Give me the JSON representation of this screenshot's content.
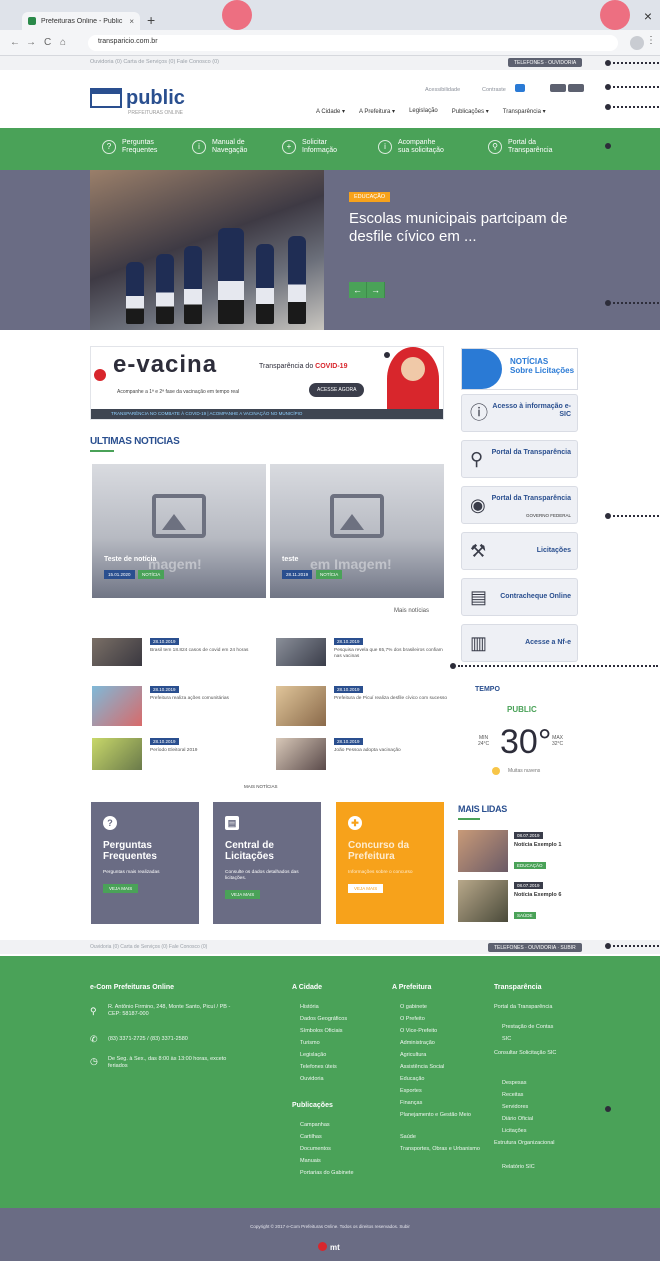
{
  "browser": {
    "tab_title": "Prefeituras Online - Public",
    "tab_close": "×",
    "new_tab": "+",
    "window_close": "×",
    "url": "transparicio.com.br",
    "back": "←",
    "forward": "→",
    "reload": "C",
    "home": "⌂",
    "menu": "⋮"
  },
  "utility": {
    "crumbs": "Ouvidoria (0)   Carta de Serviços (0)   Fale Conosco (0)",
    "telefones_label": "TELEFONES · OUVIDORIA"
  },
  "header": {
    "logo_text": "public",
    "logo_sub": "PREFEITURAS ONLINE",
    "accessibility": "Acessibilidade",
    "contrast": "Contraste",
    "nav": [
      "A Cidade ▾",
      "A Prefeitura ▾",
      "Legislação",
      "Publicações ▾",
      "Transparência ▾"
    ]
  },
  "quicklinks": [
    {
      "icon": "?",
      "label1": "Perguntas",
      "label2": "Frequentes"
    },
    {
      "icon": "i",
      "label1": "Manual de",
      "label2": "Navegação"
    },
    {
      "icon": "+",
      "label1": "Solicitar",
      "label2": "Informação"
    },
    {
      "icon": "i",
      "label1": "Acompanhe",
      "label2": "sua solicitação"
    },
    {
      "icon": "⚲",
      "label1": "Portal da",
      "label2": "Transparência"
    }
  ],
  "hero": {
    "badge": "EDUCAÇÃO",
    "title": "Escolas municipais partcipam de desfile cívico em ...",
    "prev": "←",
    "next": "→"
  },
  "vacina": {
    "title": "e-vacina",
    "subtitle_pre": "Transparência do ",
    "subtitle_hl": "COVID-19",
    "desc": "Acompanhe a 1ª e 2ª fase da vacinação em tempo real",
    "button": "ACESSE AGORA",
    "strip": "TRANSPARÊNCIA NO COMBATE À COVID-19 | ACOMPANHE A VACINAÇÃO NO MUNICÍPIO"
  },
  "ultimas": {
    "title": "ULTIMAS NOTICIAS",
    "cards": [
      {
        "title": "Teste de notícia",
        "watermark": "magem!",
        "date": "15.01.2020",
        "tag": "NOTÍCIA"
      },
      {
        "title": "teste",
        "watermark": "em Imagem!",
        "date": "28.11.2019",
        "tag": "NOTÍCIA"
      }
    ],
    "more": "Mais notícias",
    "list": [
      {
        "date": "28.10.2019",
        "text": "Brasil tem 18.824 casos de covid em 24 horas"
      },
      {
        "date": "28.10.2019",
        "text": "Pesquisa revela que 65,7% dos brasileiros confiam nas vacinas"
      },
      {
        "date": "28.10.2019",
        "text": "Prefeitura realiza ações comunitárias"
      },
      {
        "date": "28.10.2019",
        "text": "Prefeitura de Picuí realiza desfile cívico com sucesso"
      },
      {
        "date": "28.10.2019",
        "text": "Período Eleitoral 2019"
      },
      {
        "date": "28.10.2019",
        "text": "João Pessoa adopta vacinação"
      }
    ],
    "more_news": "MAIS NOTÍCIAS"
  },
  "bottom_cards": [
    {
      "icon": "?",
      "title1": "Perguntas",
      "title2": "Frequentes",
      "desc": "Perguntas mais realizadas",
      "btn": "VEJA MAIS"
    },
    {
      "icon": "▤",
      "title1": "Central de",
      "title2": "Licitações",
      "desc": "Consulte os dados detalhados das licitações.",
      "btn": "VEJA MAIS"
    },
    {
      "icon": "✚",
      "title1": "Concurso da",
      "title2": "Prefeitura",
      "desc": "Informações sobre o concurso",
      "btn": "VEJA MAIS"
    }
  ],
  "sidebar": {
    "noticias_l1": "NOTÍCIAS",
    "noticias_l2": "Sobre Licitações",
    "buttons": [
      {
        "icon": "ⓘ",
        "label": "Acesso à informação e-SIC",
        "sub": ""
      },
      {
        "icon": "⚲",
        "label": "Portal da Transparência",
        "sub": ""
      },
      {
        "icon": "◉",
        "label": "Portal da Transparência",
        "sub": "GOVERNO FEDERAL"
      },
      {
        "icon": "⚒",
        "label": "Licitações",
        "sub": ""
      },
      {
        "icon": "▤",
        "label": "Contracheque Online",
        "sub": ""
      },
      {
        "icon": "▥",
        "label": "Acesse a Nf-e",
        "sub": ""
      }
    ]
  },
  "tempo": {
    "title": "TEMPO",
    "city": "PUBLIC",
    "min_label": "MIN",
    "min": "24°C",
    "value": "30°",
    "max_label": "MAX",
    "max": "32°C",
    "condition": "Muitas nuvens"
  },
  "mais_lidas": {
    "title": "MAIS LIDAS",
    "items": [
      {
        "date": "08.07.2019",
        "title": "Notícia Exemplo 1",
        "tag": "EDUCAÇÃO"
      },
      {
        "date": "08.07.2019",
        "title": "Notícia Exemplo 6",
        "tag": "SAÚDE"
      }
    ]
  },
  "lowbar": {
    "crumbs": "Ouvidoria (0)   Carta de Serviços (0)   Fale Conosco (0)",
    "pill": "TELEFONES · OUVIDORIA · SUBIR"
  },
  "footer": {
    "org": "e-Com Prefeituras Online",
    "address": "R. Antônio Firmino, 248, Monte Santo, Picuí / PB - CEP: 58187-000",
    "phone": "(83) 3371-2725 / (83) 3371-2580",
    "hours": "De Seg. à Sex., das 8:00 às 13:00 horas, exceto feriados",
    "col_cidade": "A Cidade",
    "cidade": [
      "História",
      "Dados Geográficos",
      "Símbolos Oficiais",
      "Turismo",
      "Legislação",
      "Telefones úteis",
      "Ouvidoria"
    ],
    "col_publicacoes": "Publicações",
    "publicacoes": [
      "Campanhas",
      "Cartilhas",
      "Documentos",
      "Manuais",
      "Portarias do Gabinete"
    ],
    "col_prefeitura": "A Prefeitura",
    "prefeitura": [
      "O gabinete",
      "O Prefeito",
      "O Vice-Prefeito",
      "Administração",
      "Agricultura",
      "Assistência Social",
      "Educação",
      "Esportes",
      "Finanças",
      "Planejamento e Gestão Meio",
      "Saúde",
      "Transportes, Obras e Urbanismo"
    ],
    "col_transparencia": "Transparência",
    "transparencia": [
      "Portal da Transparência",
      "Prestação de Contas",
      "SIC",
      "Consultar Solicitação SIC",
      "Despesas",
      "Receitas",
      "Servidores",
      "Diário Oficial",
      "Licitações",
      "Estrutura Organizacional",
      "Relatório SIC"
    ],
    "copyright": "Copyright © 2017 e-Com Prefeituras Online. Todos os direitos reservados. Subir",
    "brand": "mt"
  }
}
